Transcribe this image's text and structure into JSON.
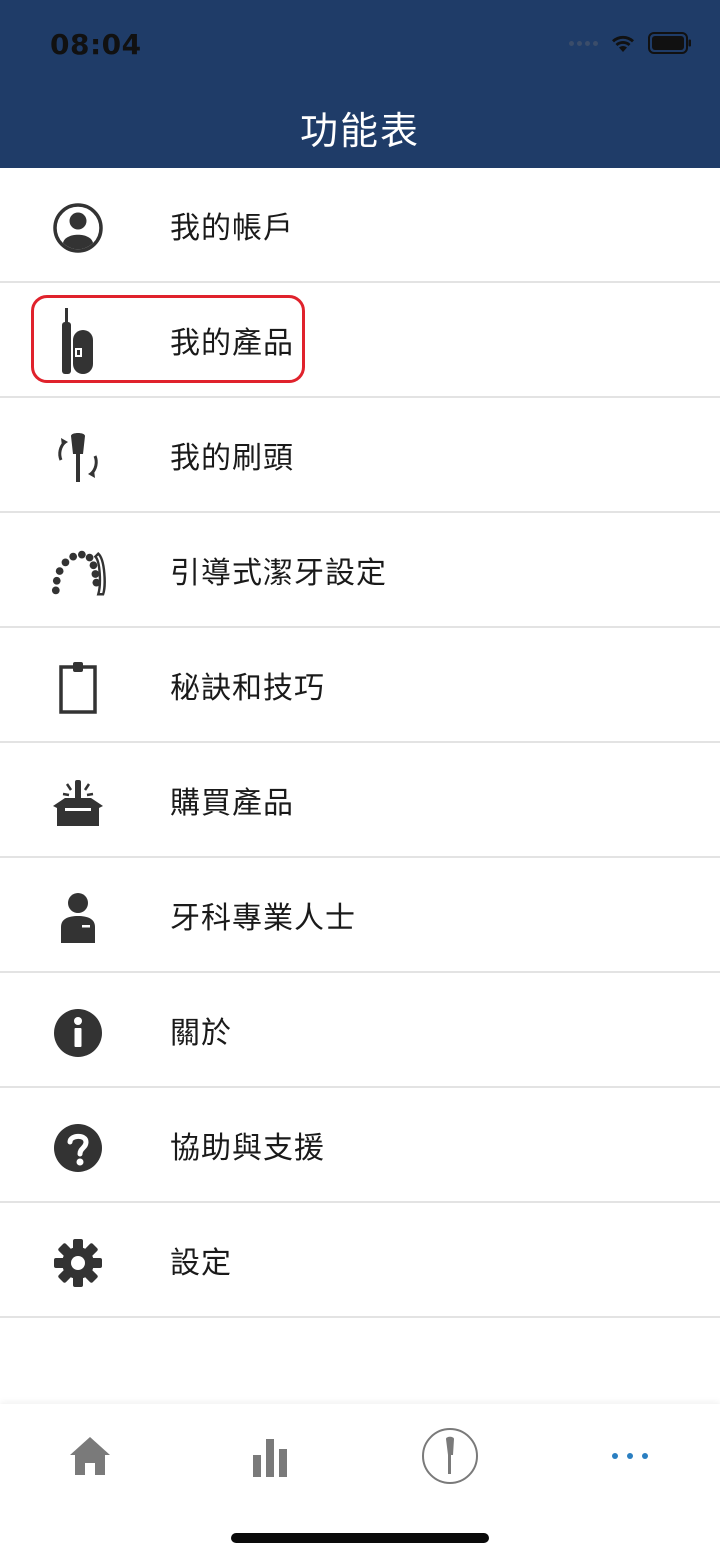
{
  "status_bar": {
    "time": "08:04"
  },
  "header": {
    "title": "功能表"
  },
  "menu": {
    "items": [
      {
        "label": "我的帳戶",
        "icon": "account-icon"
      },
      {
        "label": "我的產品",
        "icon": "toothbrush-icon"
      },
      {
        "label": "我的刷頭",
        "icon": "brush-head-icon"
      },
      {
        "label": "引導式潔牙設定",
        "icon": "teeth-icon"
      },
      {
        "label": "秘訣和技巧",
        "icon": "clipboard-icon"
      },
      {
        "label": "購買產品",
        "icon": "product-box-icon"
      },
      {
        "label": "牙科專業人士",
        "icon": "dental-professional-icon"
      },
      {
        "label": "關於",
        "icon": "info-icon"
      },
      {
        "label": "協助與支援",
        "icon": "help-icon"
      },
      {
        "label": "設定",
        "icon": "gear-icon"
      }
    ]
  },
  "tabbar": {
    "tabs": [
      {
        "icon": "home-icon"
      },
      {
        "icon": "stats-icon"
      },
      {
        "icon": "brush-icon"
      },
      {
        "icon": "more-icon"
      }
    ]
  },
  "colors": {
    "header_bg": "#1f3c68",
    "icon_dark": "#333333",
    "tab_icon": "#7a7a7a",
    "tab_active": "#2a7fc1",
    "highlight": "#e0222c"
  }
}
